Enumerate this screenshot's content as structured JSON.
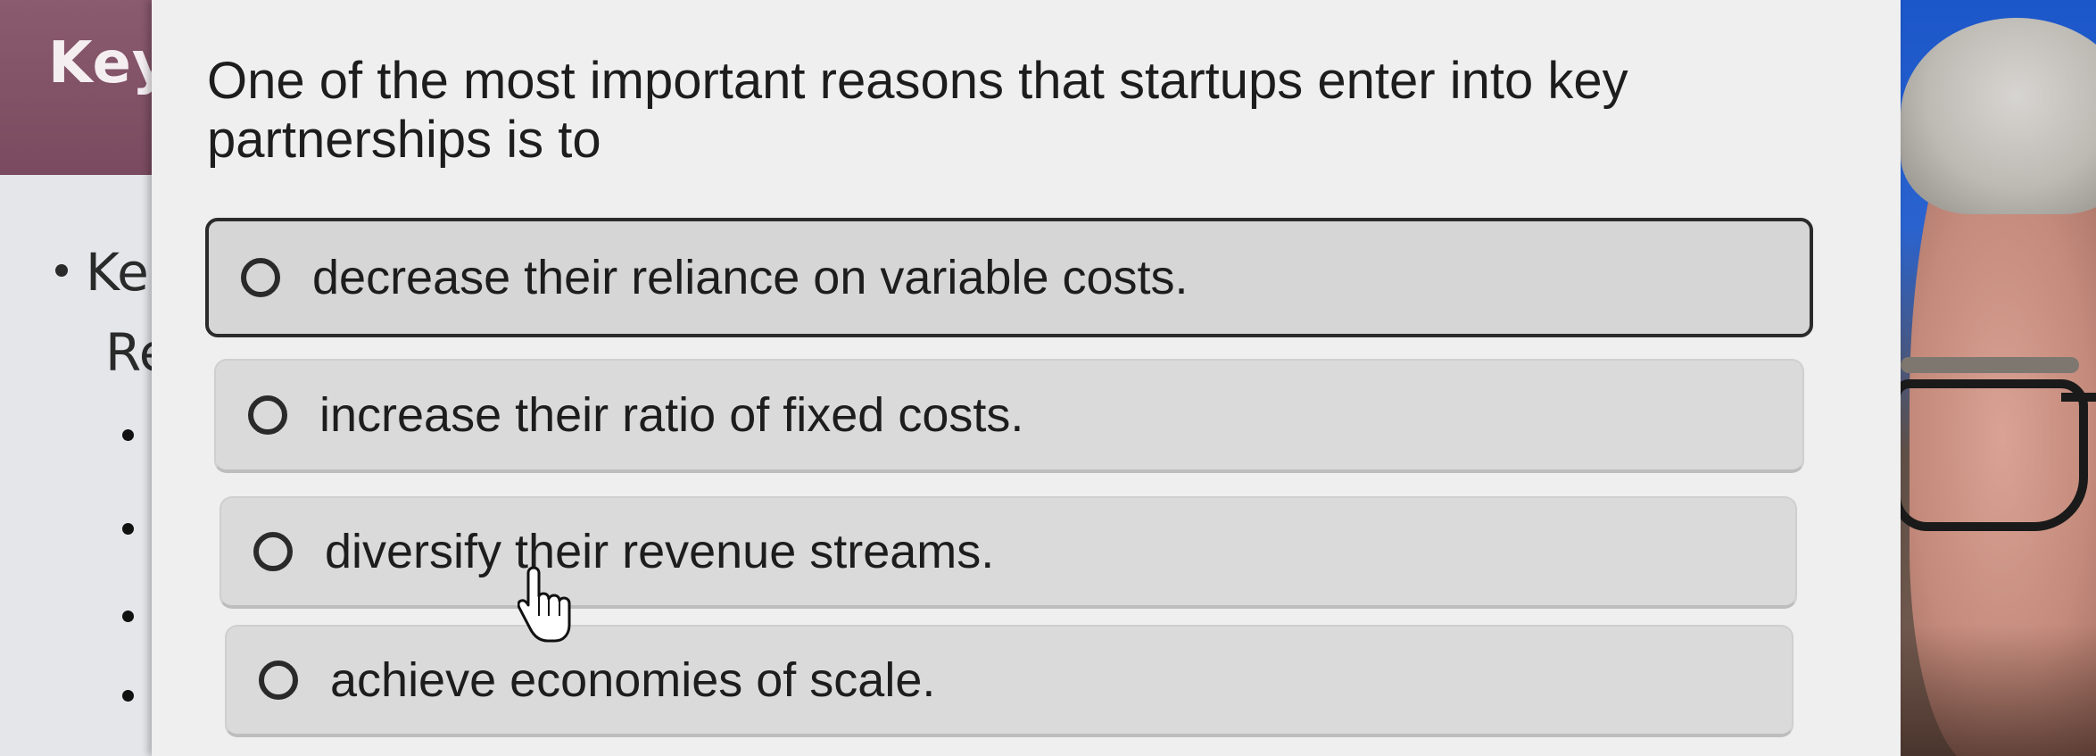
{
  "background_slide": {
    "title": "Key",
    "bullet_partial_1": "Ke",
    "bullet_partial_2": "Re"
  },
  "quiz": {
    "question": "One of the most important reasons that startups enter into key partnerships is to",
    "options": [
      {
        "label": "decrease their reliance on variable costs.",
        "selected": true
      },
      {
        "label": "increase their ratio of fixed costs.",
        "selected": false
      },
      {
        "label": "diversify their revenue streams.",
        "selected": false
      },
      {
        "label": "achieve economies of scale.",
        "selected": false
      }
    ]
  },
  "icons": {
    "cursor": "hand-pointer-icon",
    "radio": "radio-button-icon"
  },
  "colors": {
    "slide_header": "#7a4a60",
    "panel_background": "#efefef",
    "option_background": "#dadada",
    "selected_border": "#2b2b2b",
    "presenter_background": "#1c57c9"
  }
}
